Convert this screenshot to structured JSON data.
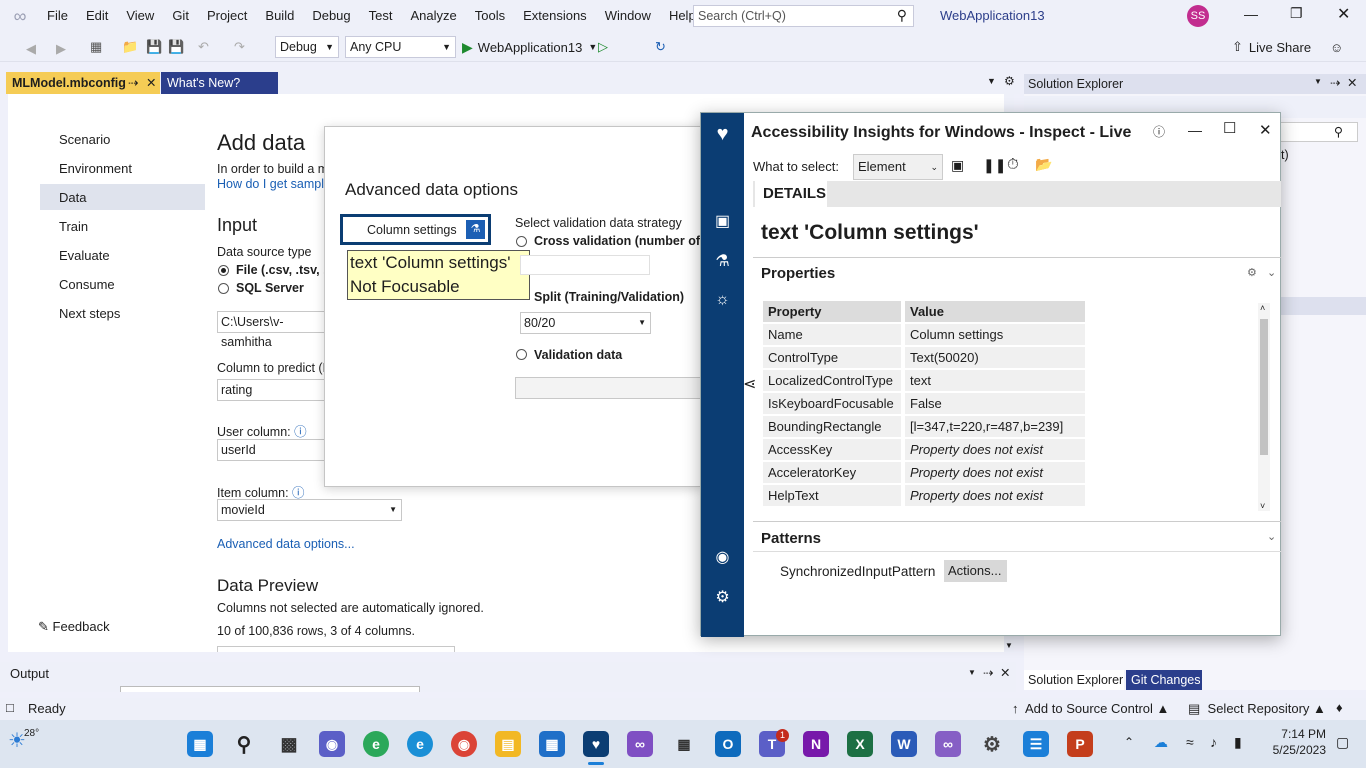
{
  "menu": [
    "File",
    "Edit",
    "View",
    "Git",
    "Project",
    "Build",
    "Debug",
    "Test",
    "Analyze",
    "Tools",
    "Extensions",
    "Window",
    "Help"
  ],
  "search": {
    "placeholder": "Search (Ctrl+Q)"
  },
  "solution_name": "WebApplication13",
  "user_initials": "SS",
  "toolbar": {
    "config": "Debug",
    "platform": "Any CPU",
    "run_target": "WebApplication13",
    "live_share": "Live Share"
  },
  "tabs": {
    "active": "MLModel.mbconfig",
    "other": "What's New?"
  },
  "nav": [
    "Scenario",
    "Environment",
    "Data",
    "Train",
    "Evaluate",
    "Consume",
    "Next steps"
  ],
  "feedback": "Feedback",
  "page": {
    "title": "Add data",
    "intro": "In order to build a m",
    "intro_link": "How do I get sample",
    "input_heading": "Input",
    "source_type_label": "Data source type",
    "source_file": "File (.csv, .tsv, .tx",
    "source_sql": "SQL Server",
    "path_value": "C:\\Users\\v-samhitha",
    "column_predict_label": "Column to predict (F",
    "column_predict_value": "rating",
    "user_column_label": "User column:",
    "user_column_value": "userId",
    "item_column_label": "Item column:",
    "item_column_value": "movieId",
    "advanced_link": "Advanced data options...",
    "preview_heading": "Data Preview",
    "preview_note": "Columns not selected are automatically ignored.",
    "preview_count": "10 of 100,836 rows, 3 of 4 columns."
  },
  "dialog": {
    "title": "Advanced data options",
    "column_settings": "Column settings",
    "tooltip_line1": "text 'Column settings'",
    "tooltip_line2": "Not Focusable",
    "strategy_label": "Select validation data strategy",
    "cross_validation": "Cross validation (number of fo",
    "split": "Split (Training/Validation)",
    "split_value": "80/20",
    "validation_data": "Validation data"
  },
  "solution_explorer": {
    "title": "Solution Explorer",
    "tab1": "Solution Explorer",
    "tab2": "Git Changes",
    "fragment": "t)"
  },
  "accessibility": {
    "title": "Accessibility Insights for Windows - Inspect - Live",
    "what_to_select_label": "What to select:",
    "what_to_select_value": "Element",
    "details_tab": "DETAILS",
    "element_heading": "text 'Column settings'",
    "properties_heading": "Properties",
    "col_property": "Property",
    "col_value": "Value",
    "rows": [
      {
        "p": "Name",
        "v": "Column settings"
      },
      {
        "p": "ControlType",
        "v": "Text(50020)"
      },
      {
        "p": "LocalizedControlType",
        "v": "text"
      },
      {
        "p": "IsKeyboardFocusable",
        "v": "False"
      },
      {
        "p": "BoundingRectangle",
        "v": "[l=347,t=220,r=487,b=239]"
      },
      {
        "p": "AccessKey",
        "v": "Property does not exist"
      },
      {
        "p": "AcceleratorKey",
        "v": "Property does not exist"
      },
      {
        "p": "HelpText",
        "v": "Property does not exist"
      }
    ],
    "patterns_heading": "Patterns",
    "pattern_name": "SynchronizedInputPattern",
    "actions_button": "Actions..."
  },
  "output": {
    "title": "Output"
  },
  "status": {
    "ready": "Ready",
    "source_control": "Add to Source Control",
    "repository": "Select Repository"
  },
  "taskbar": {
    "weather": "28°",
    "time": "7:14 PM",
    "date": "5/25/2023",
    "teams_badge": "1"
  }
}
